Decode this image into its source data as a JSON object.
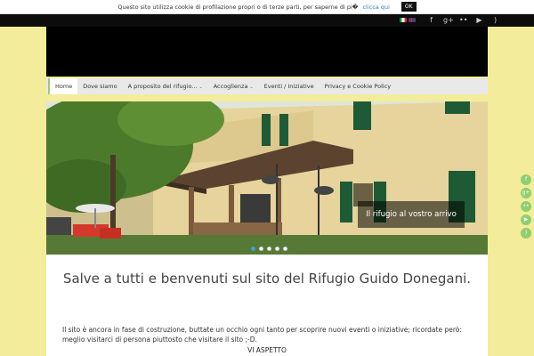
{
  "cookie": {
    "message": "Questo sito utilizza cookie di profilazione propri o di terze parti, per saperne di pi�",
    "link": "clicca qui",
    "ok": "OK"
  },
  "topbar": {
    "languages": [
      "it",
      "en"
    ],
    "social_icons": [
      "facebook-icon",
      "google-plus-icon",
      "flickr-icon",
      "youtube-icon",
      "rss-icon"
    ]
  },
  "social_glyphs": {
    "facebook": "f",
    "google_plus": "g+",
    "flickr": "••",
    "youtube": "▶",
    "rss": ")"
  },
  "nav": {
    "items": [
      {
        "label": "Home",
        "active": true
      },
      {
        "label": "Dove siamo"
      },
      {
        "label": "A proposito del rifugio...",
        "dropdown": true
      },
      {
        "label": "Accoglienza",
        "dropdown": true
      },
      {
        "label": "Eventi / Iniziative"
      },
      {
        "label": "Privacy e Cookie Policy"
      }
    ],
    "chevron": "⌄"
  },
  "slider": {
    "caption": "Il rifugio al vostro arrivo",
    "slides": 5,
    "active_slide": 1
  },
  "content": {
    "welcome": "Salve a tutti e benvenuti sul sito del Rifugio Guido Donegani.",
    "intro": "Il sito è ancora in fase di costruzione, buttate un occhio ogni tanto per scoprire nuovi eventi o iniziative; ricordate però: meglio visitarci di persona piuttosto che visitare il sito ;-D.",
    "closing": "VI ASPETTO"
  },
  "side_share": [
    "facebook-icon",
    "google-plus-icon",
    "flickr-icon",
    "youtube-icon",
    "rss-icon"
  ],
  "colors": {
    "accent": "#3aa0d8",
    "share": "#8fcf6e",
    "page_bg": "#f3ec9b"
  }
}
